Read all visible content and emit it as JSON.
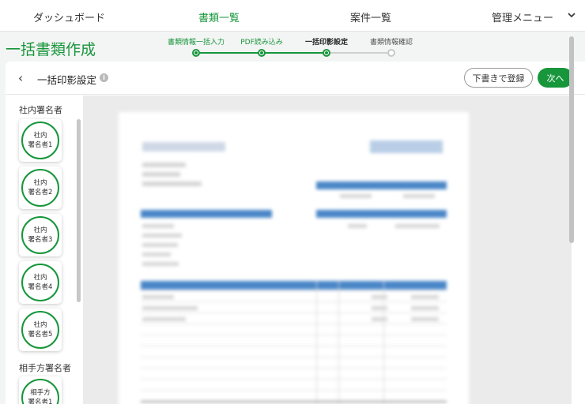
{
  "nav": {
    "items": [
      {
        "label": "ダッシュボード"
      },
      {
        "label": "書類一覧"
      },
      {
        "label": "案件一覧"
      },
      {
        "label": "管理メニュー"
      }
    ],
    "active": "書類一覧"
  },
  "page": {
    "title": "一括書類作成"
  },
  "steps": [
    {
      "label": "書類情報一括入力",
      "state": "done"
    },
    {
      "label": "PDF読み込み",
      "state": "done"
    },
    {
      "label": "一括印影設定",
      "state": "current"
    },
    {
      "label": "書類情報確認",
      "state": "pending"
    }
  ],
  "header": {
    "title": "一括印影設定",
    "draft_label": "下書きで登録",
    "next_label": "次へ"
  },
  "palette": {
    "internal_title": "社内署名者",
    "internal": [
      {
        "line1": "社内",
        "line2": "署名者1"
      },
      {
        "line1": "社内",
        "line2": "署名者2"
      },
      {
        "line1": "社内",
        "line2": "署名者3"
      },
      {
        "line1": "社内",
        "line2": "署名者4"
      },
      {
        "line1": "社内",
        "line2": "署名者5"
      }
    ],
    "external_title": "相手方署名者",
    "external": [
      {
        "line1": "相手方",
        "line2": "署名者1"
      }
    ]
  },
  "colors": {
    "accent": "#17963b",
    "doc_blue": "#4a86c8"
  },
  "icons": {
    "back": "chevron-left-icon",
    "info": "info-icon",
    "menu": "chevron-down-icon"
  }
}
